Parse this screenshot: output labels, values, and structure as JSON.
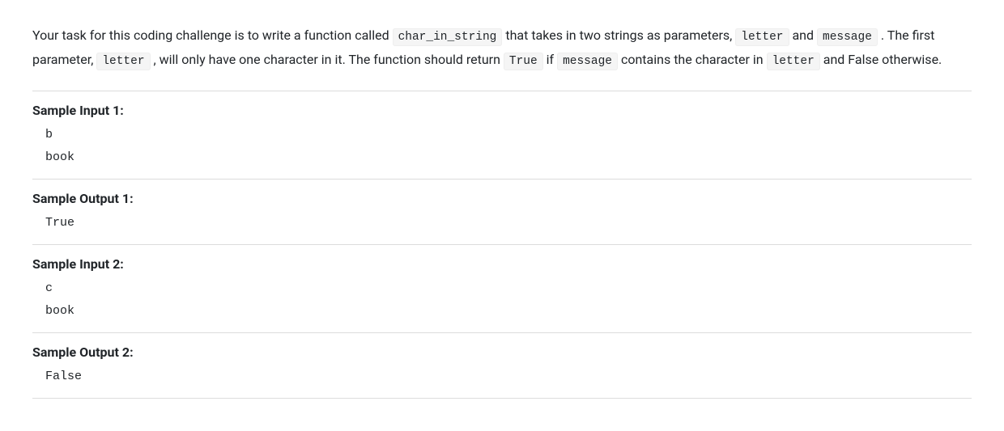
{
  "problem": {
    "parts": [
      {
        "type": "text",
        "value": "Your task for this coding challenge is to write a function called "
      },
      {
        "type": "code",
        "value": "char_in_string"
      },
      {
        "type": "text",
        "value": " that takes in two strings as parameters, "
      },
      {
        "type": "code",
        "value": "letter"
      },
      {
        "type": "text",
        "value": " and "
      },
      {
        "type": "code",
        "value": "message"
      },
      {
        "type": "text",
        "value": " . The first parameter, "
      },
      {
        "type": "code",
        "value": "letter"
      },
      {
        "type": "text",
        "value": " , will only have one character in it. The function should return "
      },
      {
        "type": "code",
        "value": "True"
      },
      {
        "type": "text",
        "value": " if "
      },
      {
        "type": "code",
        "value": "message"
      },
      {
        "type": "text",
        "value": " contains the character in "
      },
      {
        "type": "code",
        "value": "letter"
      },
      {
        "type": "text",
        "value": " and False otherwise."
      }
    ]
  },
  "samples": [
    {
      "label": "Sample Input 1:",
      "content": "b\nbook"
    },
    {
      "label": "Sample Output 1:",
      "content": "True"
    },
    {
      "label": "Sample Input 2:",
      "content": "c\nbook"
    },
    {
      "label": "Sample Output 2:",
      "content": "False"
    }
  ]
}
